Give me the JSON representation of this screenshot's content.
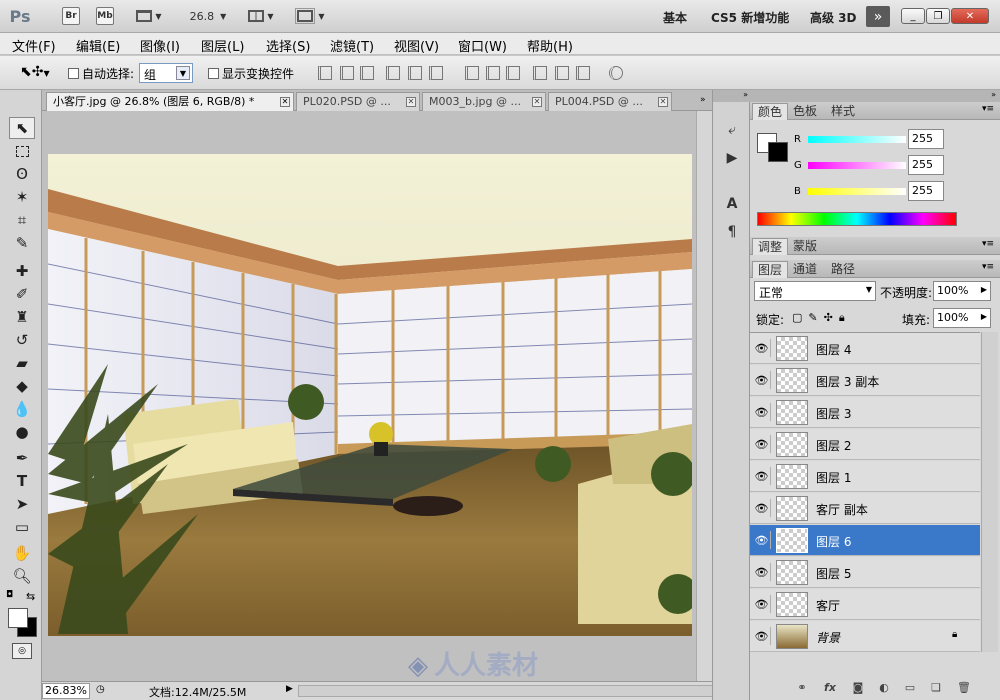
{
  "appbar": {
    "logo": "Ps",
    "br_button": "Br",
    "mb_button": "Mb",
    "zoom_value": "26.8",
    "workspaces": [
      "基本",
      "CS5 新增功能",
      "高级 3D"
    ],
    "more_icon": "double-chevron-right-icon"
  },
  "menubar": {
    "items": [
      "文件(F)",
      "编辑(E)",
      "图像(I)",
      "图层(L)",
      "选择(S)",
      "滤镜(T)",
      "视图(V)",
      "窗口(W)",
      "帮助(H)"
    ]
  },
  "optionsbar": {
    "auto_select_label": "自动选择:",
    "auto_select_value": "组",
    "show_transform_label": "显示变换控件"
  },
  "tabs": [
    {
      "label": "小客厅.jpg @ 26.8% (图层 6, RGB/8) *",
      "active": true
    },
    {
      "label": "PL020.PSD @ ...",
      "active": false
    },
    {
      "label": "M003_b.jpg @ ...",
      "active": false
    },
    {
      "label": "PL004.PSD @ ...",
      "active": false
    }
  ],
  "statusbar": {
    "zoom": "26.83%",
    "doc_info": "文档:12.4M/25.5M"
  },
  "watermark": {
    "text": "人人素材"
  },
  "color_panel": {
    "tabs": [
      "颜色",
      "色板",
      "样式"
    ],
    "r_label": "R",
    "g_label": "G",
    "b_label": "B",
    "r_value": "255",
    "g_value": "255",
    "b_value": "255"
  },
  "adjust_panel": {
    "tabs": [
      "调整",
      "蒙版"
    ]
  },
  "layers_panel": {
    "tabs": [
      "图层",
      "通道",
      "路径"
    ],
    "blend_mode": "正常",
    "opacity_label": "不透明度:",
    "opacity_value": "100%",
    "lock_label": "锁定:",
    "fill_label": "填充:",
    "fill_value": "100%",
    "layers": [
      {
        "name": "图层 4",
        "selected": false
      },
      {
        "name": "图层 3 副本",
        "selected": false
      },
      {
        "name": "图层 3",
        "selected": false
      },
      {
        "name": "图层 2",
        "selected": false
      },
      {
        "name": "图层 1",
        "selected": false
      },
      {
        "name": "客厅 副本",
        "selected": false
      },
      {
        "name": "图层 6",
        "selected": true
      },
      {
        "name": "图层 5",
        "selected": false
      },
      {
        "name": "客厅",
        "selected": false
      },
      {
        "name": "背景",
        "selected": false
      }
    ]
  },
  "colors": {
    "selected_layer": "#3a78c9",
    "chrome": "#d8d8d8",
    "canvas_bg": "#c0c0c0"
  }
}
